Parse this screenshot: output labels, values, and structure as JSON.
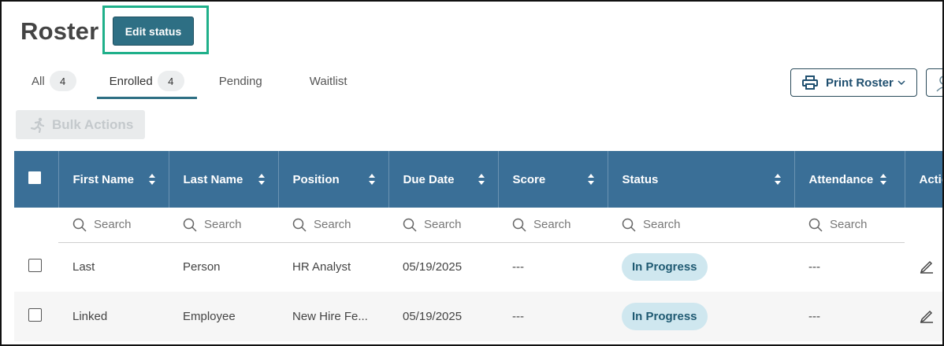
{
  "page": {
    "title": "Roster"
  },
  "header": {
    "edit_status_label": "Edit status"
  },
  "tabs": [
    {
      "label": "All",
      "count": "4"
    },
    {
      "label": "Enrolled",
      "count": "4"
    },
    {
      "label": "Pending"
    },
    {
      "label": "Waitlist"
    }
  ],
  "toolbar": {
    "print_label": "Print Roster",
    "bulk_label": "Bulk Actions"
  },
  "table": {
    "columns": [
      "First Name",
      "Last Name",
      "Position",
      "Due Date",
      "Score",
      "Status",
      "Attendance",
      "Actions"
    ],
    "search_placeholder": "Search",
    "rows": [
      {
        "first": "Last",
        "last": "Person",
        "position": "HR Analyst",
        "due": "05/19/2025",
        "score": "---",
        "status": "In Progress",
        "attendance": "---"
      },
      {
        "first": "Linked",
        "last": "Employee",
        "position": "New Hire Fe...",
        "due": "05/19/2025",
        "score": "---",
        "status": "In Progress",
        "attendance": "---"
      }
    ]
  },
  "colors": {
    "accent": "#2e6f84",
    "header_bg": "#3a6f97",
    "badge_bg": "#cfe7ef",
    "highlight": "#1fb08a"
  }
}
